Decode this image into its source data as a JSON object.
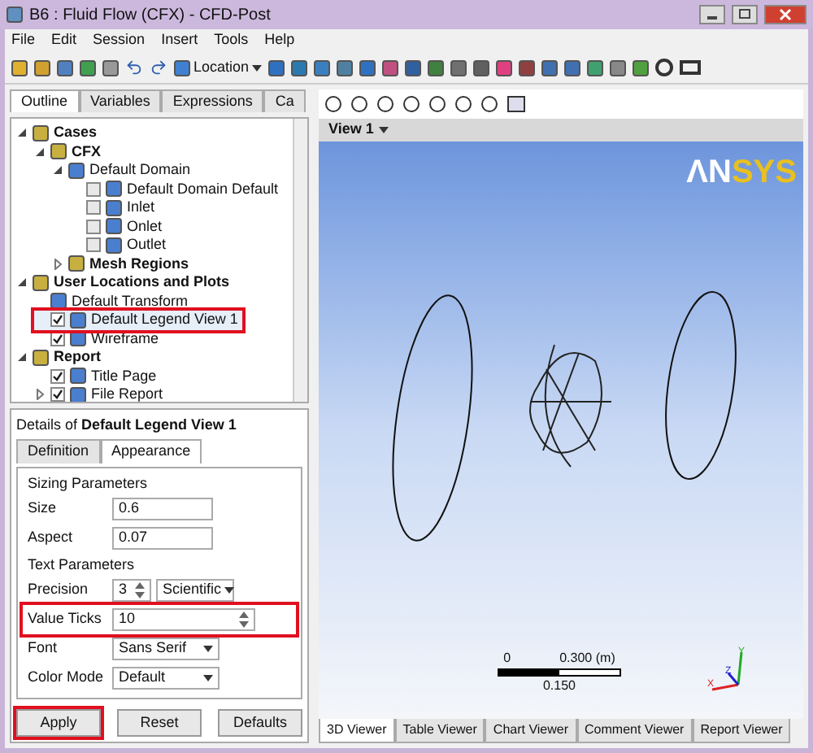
{
  "window": {
    "title": "B6 : Fluid Flow (CFX) - CFD-Post"
  },
  "menu": [
    "File",
    "Edit",
    "Session",
    "Insert",
    "Tools",
    "Help"
  ],
  "toolbar": {
    "location_label": "Location"
  },
  "left_tabs": [
    {
      "label": "Outline",
      "selected": true
    },
    {
      "label": "Variables",
      "selected": false
    },
    {
      "label": "Expressions",
      "selected": false
    },
    {
      "label": "Ca",
      "selected": false
    }
  ],
  "tree": [
    {
      "label": "Cases",
      "bold": true,
      "expanded": true,
      "children": [
        {
          "label": "CFX",
          "bold": true,
          "expanded": true,
          "children": [
            {
              "label": "Default Domain",
              "bold": false,
              "expanded": true,
              "children": [
                {
                  "label": "Default Domain Default",
                  "checked": false
                },
                {
                  "label": "Inlet",
                  "checked": false
                },
                {
                  "label": "Onlet",
                  "checked": false
                },
                {
                  "label": "Outlet",
                  "checked": false
                }
              ]
            },
            {
              "label": "Mesh Regions",
              "bold": true,
              "expanded": false
            }
          ]
        }
      ]
    },
    {
      "label": "User Locations and Plots",
      "bold": true,
      "expanded": true,
      "children": [
        {
          "label": "Default Transform"
        },
        {
          "label": "Default Legend View 1",
          "checked": true,
          "selected": true,
          "annotated": true
        },
        {
          "label": "Wireframe",
          "checked": true
        }
      ]
    },
    {
      "label": "Report",
      "bold": true,
      "expanded": true,
      "children": [
        {
          "label": "Title Page",
          "checked": true
        },
        {
          "label": "File Report",
          "checked": true,
          "expanded": false
        }
      ]
    }
  ],
  "details": {
    "prefix": "Details of",
    "object": "Default Legend View 1"
  },
  "detail_tabs": [
    {
      "label": "Definition",
      "selected": false
    },
    {
      "label": "Appearance",
      "selected": true
    }
  ],
  "groups": [
    {
      "title": "Sizing Parameters",
      "fields": [
        {
          "kind": "text",
          "label": "Size",
          "value": "0.6"
        },
        {
          "kind": "text",
          "label": "Aspect",
          "value": "0.07"
        }
      ]
    },
    {
      "title": "Text Parameters",
      "fields": [
        {
          "kind": "spin_select",
          "label": "Precision",
          "value": "3",
          "option": "Scientific"
        },
        {
          "kind": "spin",
          "label": "Value Ticks",
          "value": "10",
          "annotated": true
        },
        {
          "kind": "select",
          "label": "Font",
          "value": "Sans Serif"
        },
        {
          "kind": "select",
          "label": "Color Mode",
          "value": "Default"
        }
      ]
    }
  ],
  "buttons": [
    {
      "label": "Apply",
      "annotated": true
    },
    {
      "label": "Reset",
      "annotated": false
    },
    {
      "label": "Defaults",
      "annotated": false
    }
  ],
  "viewer": {
    "view_label": "View 1",
    "logo_a": "ΛN",
    "logo_b": "SYS",
    "scale": {
      "start": "0",
      "end": "0.300",
      "unit": "(m)",
      "mid": "0.150"
    },
    "axes": {
      "x": "X",
      "y": "Y",
      "z": "Z"
    }
  },
  "viewer_tabs": [
    {
      "label": "3D Viewer",
      "selected": true
    },
    {
      "label": "Table Viewer",
      "selected": false
    },
    {
      "label": "Chart Viewer",
      "selected": false
    },
    {
      "label": "Comment Viewer",
      "selected": false
    },
    {
      "label": "Report Viewer",
      "selected": false
    }
  ]
}
